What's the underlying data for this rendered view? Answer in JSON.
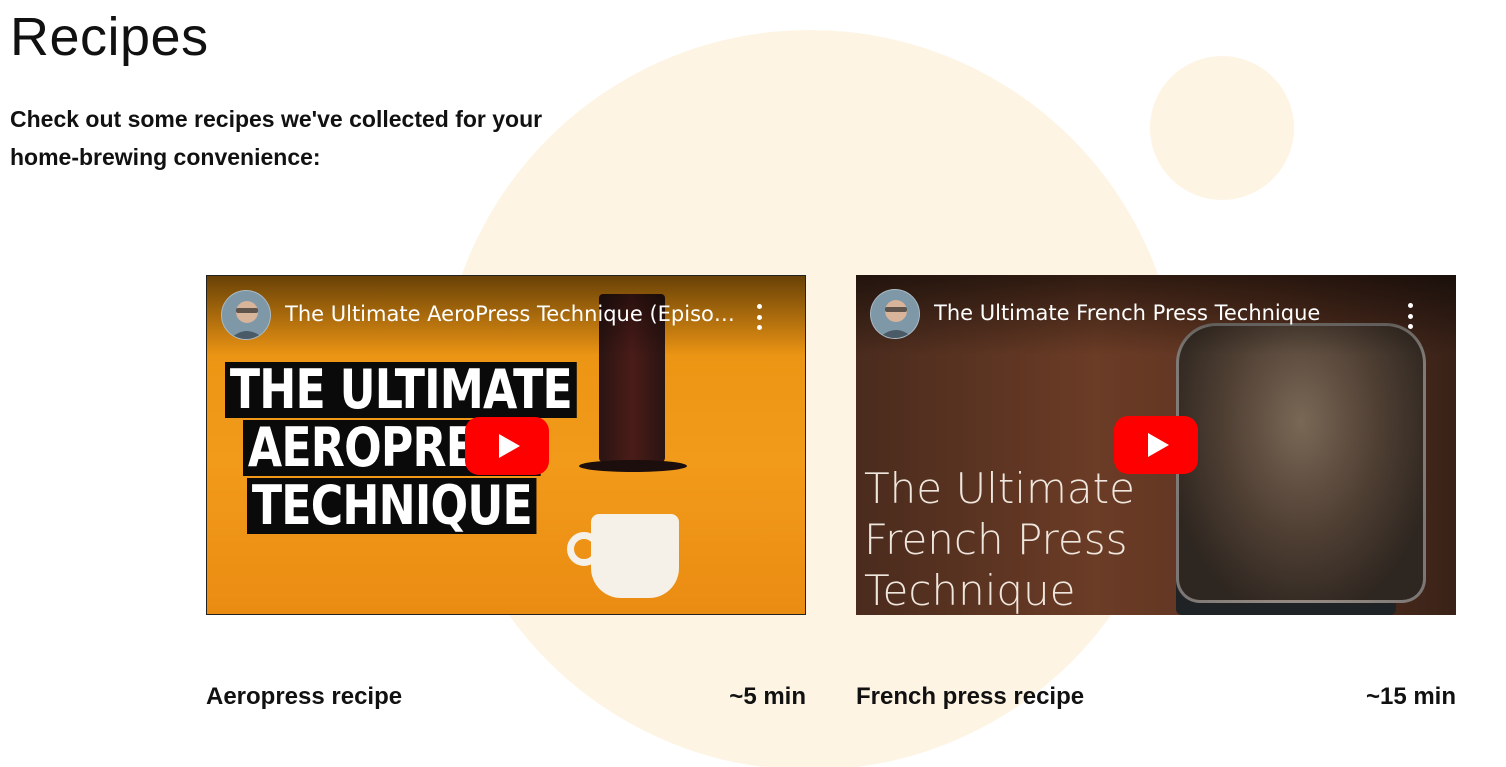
{
  "page": {
    "title": "Recipes",
    "intro": "Check out some recipes we've collected for your home-brewing convenience:"
  },
  "colors": {
    "decoration": "#fdf4e3",
    "play_button": "#ff0000",
    "text": "#111111"
  },
  "recipes": [
    {
      "video_title": "The Ultimate AeroPress Technique (Episod...",
      "thumbnail_lines": [
        "THE ULTIMATE",
        "AEROPRESS",
        "TECHNIQUE"
      ],
      "name": "Aeropress recipe",
      "duration": "~5 min"
    },
    {
      "video_title": "The Ultimate French Press Technique",
      "thumbnail_lines": [
        "The Ultimate",
        "French Press",
        "Technique"
      ],
      "name": "French press recipe",
      "duration": "~15 min"
    }
  ],
  "icons": {
    "play": "youtube-play-icon",
    "menu": "more-vert-icon"
  }
}
